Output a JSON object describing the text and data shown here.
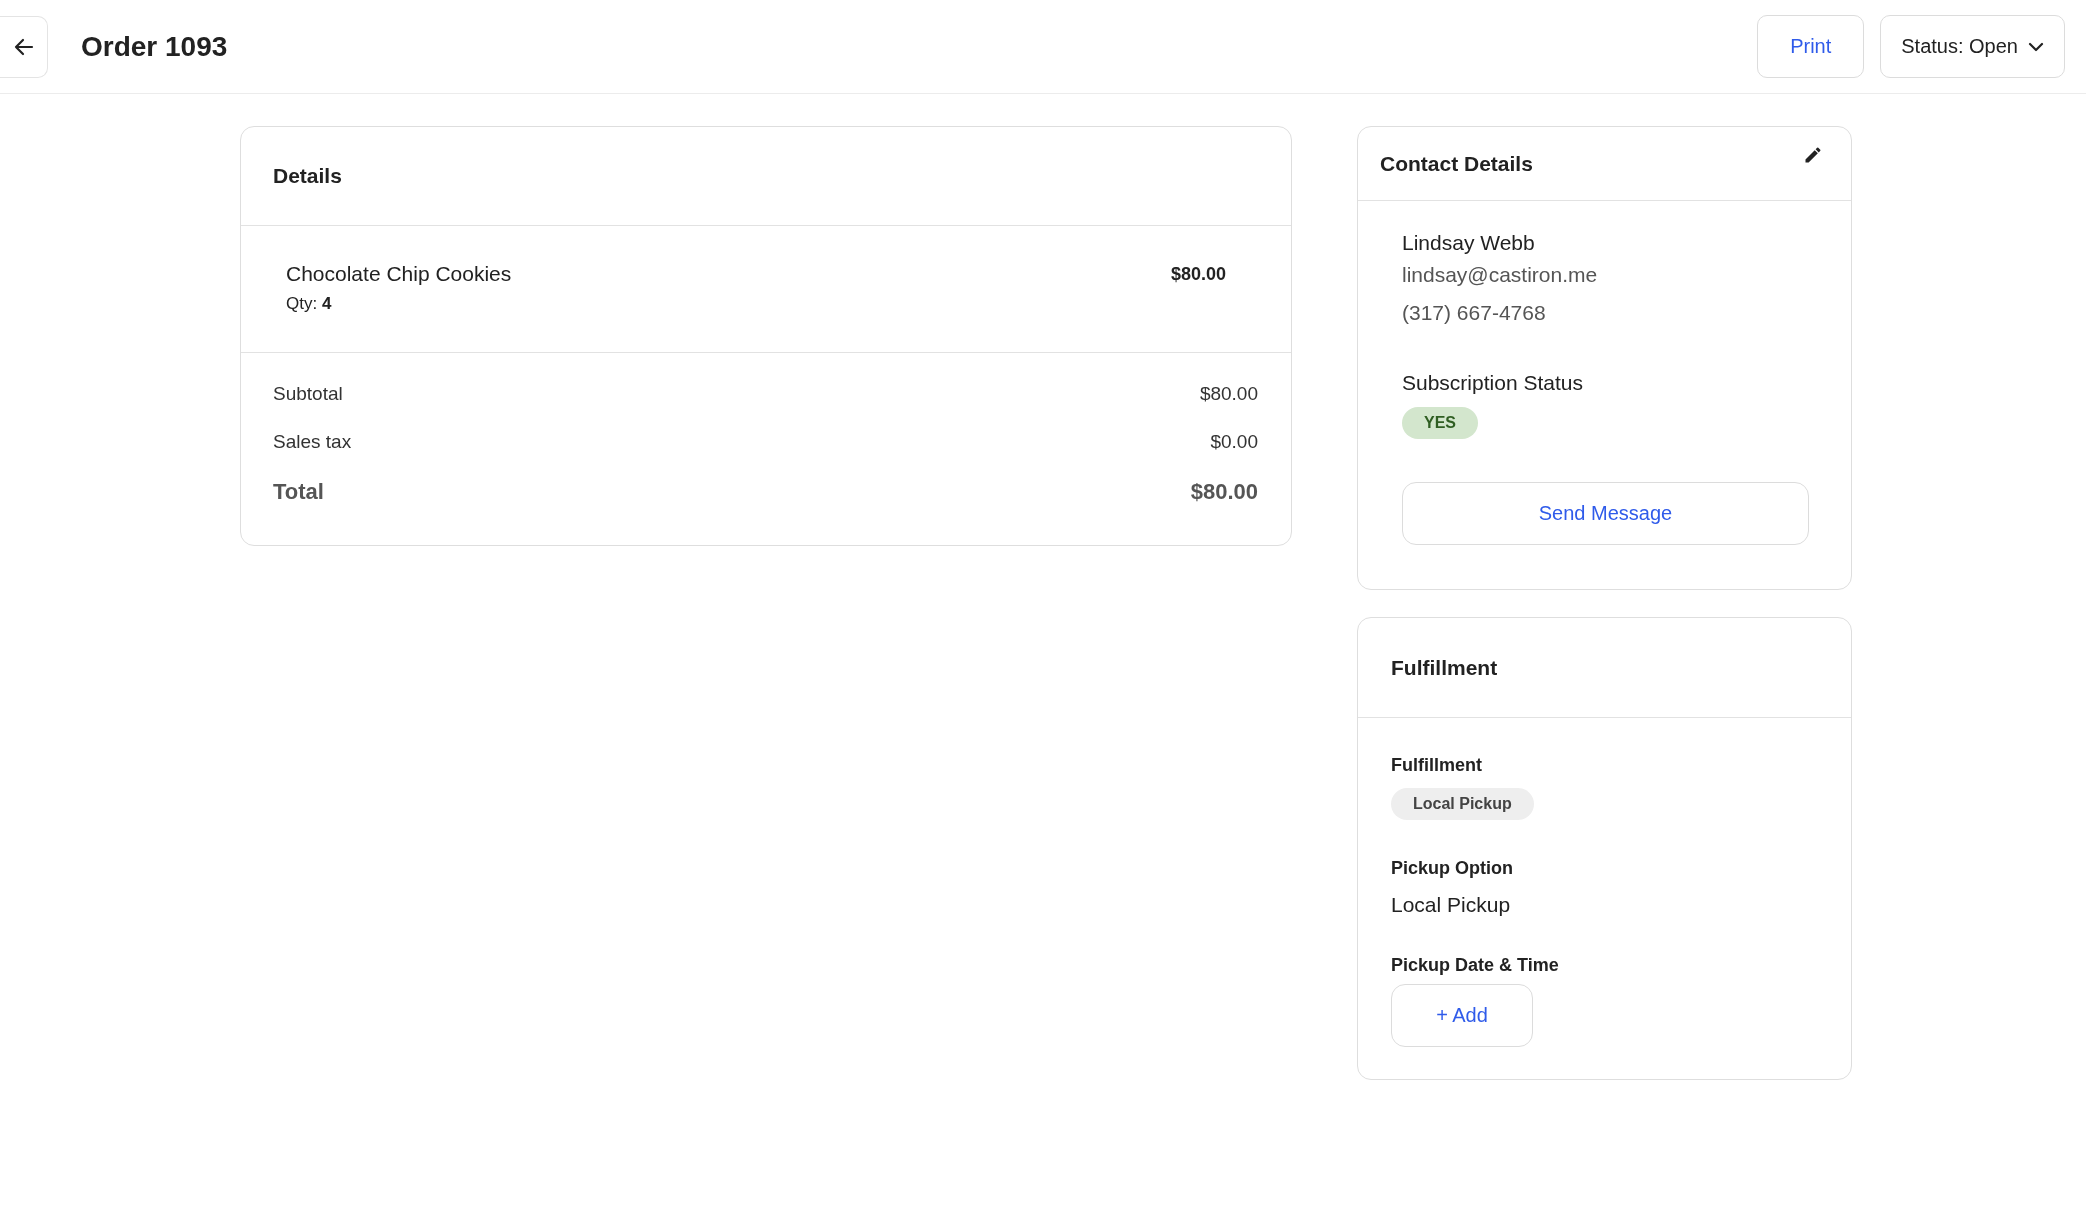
{
  "header": {
    "title": "Order 1093",
    "print_button": "Print",
    "status_button": "Status: Open"
  },
  "details": {
    "title": "Details",
    "items": [
      {
        "name": "Chocolate Chip Cookies",
        "qty": "Qty: **4**",
        "price": "$80.00"
      }
    ],
    "totals": [
      {
        "kind": "line",
        "label": "Subtotal",
        "value": "$80.00"
      },
      {
        "kind": "line",
        "label": "Sales tax",
        "value": "$0.00"
      },
      {
        "kind": "total",
        "label": "Total",
        "value": "$80.00"
      }
    ]
  },
  "contact": {
    "title": "Contact Details",
    "name": "Lindsay Webb",
    "email": "lindsay@castiron.me",
    "phone": "(317) 667-4768",
    "subscription_label": "Subscription Status",
    "subscription_value": "YES",
    "button": "Send Message"
  },
  "fulfillment": {
    "title": "Fulfillment",
    "fields": [
      {
        "kind": "chip",
        "label": "Fulfillment",
        "value": "Local Pickup"
      },
      {
        "kind": "text",
        "label": "Pickup Option",
        "value": "Local Pickup"
      },
      {
        "kind": "button",
        "label": "Pickup Date & Time",
        "value": "+ Add"
      }
    ]
  }
}
